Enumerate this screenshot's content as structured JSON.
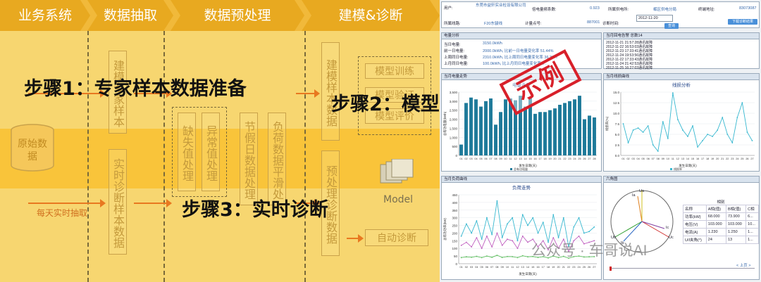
{
  "left": {
    "stages": [
      "业务系统",
      "数据抽取",
      "数据预处理",
      "建模&诊断"
    ],
    "source_db": "原始数据",
    "boxes": {
      "expert_sample": "建模专家样本",
      "realtime_sample": "实时诊断样本数据",
      "missing": "缺失值处理",
      "abnormal": "异常值处理",
      "holiday": "节假日数据处理",
      "load_smooth": "负荷数据平滑处",
      "model_data": "建模样本数据",
      "preprocess_data": "预处理诊断数据",
      "model_train": "模型训练",
      "model_verify": "模型验证",
      "model_eval": "模型评价",
      "model_label": "Model",
      "auto_diag": "自动诊断"
    },
    "daily_extract": "每天实时抽取",
    "step1": "步骤1：专家样本数据准备",
    "step2": "步骤2：模型",
    "step3": "步骤3：实时诊断"
  },
  "right": {
    "top": {
      "user_label": "用户:",
      "user_value": "东莞市益轩实业检设有限公司",
      "ratio_label": "倍电量频系数:",
      "ratio_value": "0.923",
      "station_label": "所属供电所:",
      "station_value": "岷区供电分局",
      "terminal_label": "终端地址:",
      "terminal_value": "83073087",
      "line_label": "所属线路:",
      "line_value": "F20东骏线",
      "meter_label": "计量点号:",
      "meter_value": "887001",
      "diag_label": "诊断时间:",
      "diag_value": "2012-11-20",
      "query_btn": "查询",
      "export_btn": "下载诊断结果"
    },
    "energy": {
      "title": "电量分析",
      "rows": [
        {
          "label": "当日电量:",
          "value": "3150.0kWh"
        },
        {
          "label": "前一日电量:",
          "value": "2000.0kWh, 比前一日电量变化率 51.44%"
        },
        {
          "label": "上周同日电量:",
          "value": "2310.0kWh, 比上周同日电量变化率 36.36%"
        },
        {
          "label": "上月同日电量:",
          "value": "100.0kWh, 比上月同日电量变化率 3..."
        }
      ]
    },
    "events": {
      "title": "当月回电告警 总数14",
      "items": [
        "2012-11-21 21:57:28通讯故障",
        "2012-11-22 16:53:03通讯故障",
        "2012-11-23 17:33:41通讯故障",
        "2012-11-24 19:53:56通讯故障",
        "2012-11-22 17:33:43通讯故障",
        "2012-11-24 21:42:53通讯故障",
        "2012-11-25 16:27:03通讯故障"
      ]
    },
    "stamp": "示例",
    "watermark": "公众号 · 车哥说AI",
    "charts": [
      {
        "panel_title": "当月电量走势",
        "chart_data": {
          "type": "bar",
          "title": "电量走势",
          "xlabel": "发生日期(天)",
          "ylabel": "总有功电量(kWh)",
          "ylim": [
            0,
            3500
          ],
          "yticks": [
            "0",
            "500",
            "1,000",
            "1,500",
            "2,000",
            "2,500",
            "3,000",
            "3,500"
          ],
          "categories": [
            "01",
            "02",
            "03",
            "04",
            "05",
            "06",
            "07",
            "08",
            "09",
            "10",
            "11",
            "12",
            "13",
            "14",
            "15",
            "16",
            "17",
            "18",
            "19",
            "20",
            "21",
            "22",
            "23",
            "24",
            "25",
            "26",
            "27",
            "28"
          ],
          "values": [
            600,
            2900,
            3200,
            3100,
            2700,
            3000,
            3150,
            1700,
            2400,
            3100,
            3150,
            3050,
            3300,
            2700,
            3200,
            2300,
            2400,
            2400,
            2500,
            2600,
            2800,
            2900,
            3000,
            3100,
            3300,
            2000,
            2200,
            2100
          ],
          "legend": [
            "总有功电量"
          ]
        }
      },
      {
        "panel_title": "当月线损曲线",
        "chart_data": {
          "type": "line",
          "title": "线损分析",
          "xlabel": "发生日期(天)",
          "ylabel": "线损率(%)",
          "ylim": [
            0,
            15.0
          ],
          "yticks": [
            "0.0",
            "2.5",
            "5.0",
            "7.5",
            "10.0",
            "12.5",
            "15.0"
          ],
          "categories": [
            "01",
            "02",
            "03",
            "04",
            "05",
            "06",
            "07",
            "08",
            "09",
            "10",
            "11",
            "12",
            "13",
            "14",
            "15",
            "16",
            "17",
            "18",
            "19",
            "20",
            "21",
            "22",
            "23",
            "24",
            "25",
            "26",
            "27"
          ],
          "values": [
            7.5,
            3.0,
            6.0,
            6.5,
            5.5,
            7.0,
            2.5,
            1.0,
            8.0,
            4.0,
            14.8,
            8.5,
            6.0,
            4.5,
            7.0,
            2.0,
            3.5,
            5.0,
            4.5,
            6.0,
            9.0,
            5.0,
            3.0,
            9.0,
            12.5,
            5.5,
            3.5
          ],
          "legend": [
            "线损率"
          ]
        }
      },
      {
        "panel_title": "当月负荷曲线",
        "chart_data": {
          "type": "line",
          "title": "负荷走势",
          "xlabel": "发生日期(天)",
          "ylabel": "总有功功率(kW)",
          "ylim": [
            0,
            450
          ],
          "yticks": [
            "0",
            "50",
            "100",
            "150",
            "200",
            "250",
            "300",
            "350",
            "400",
            "450"
          ],
          "categories": [
            "01",
            "02",
            "03",
            "04",
            "05",
            "06",
            "07",
            "08",
            "09",
            "10",
            "11",
            "12",
            "13",
            "14",
            "15",
            "16",
            "17",
            "18",
            "19",
            "20",
            "21",
            "22",
            "23",
            "24",
            "25",
            "26",
            "27"
          ],
          "series": [
            {
              "values": [
                180,
                260,
                200,
                280,
                160,
                300,
                190,
                410,
                170,
                260,
                300,
                150,
                320,
                250,
                300,
                200,
                270,
                140,
                320,
                170,
                300,
                110,
                240,
                300,
                200,
                210,
                240
              ]
            },
            {
              "values": [
                120,
                140,
                110,
                170,
                100,
                180,
                110,
                200,
                120,
                160,
                150,
                100,
                180,
                140,
                160,
                110,
                150,
                90,
                170,
                100,
                160,
                80,
                150,
                180,
                130,
                140,
                150
              ]
            },
            {
              "values": [
                40,
                45,
                42,
                48,
                40,
                50,
                42,
                55,
                41,
                47,
                46,
                40,
                52,
                45,
                47,
                41,
                46,
                38,
                50,
                40,
                48,
                36,
                46,
                50,
                44,
                45,
                46
              ]
            }
          ]
        }
      }
    ],
    "phasor": {
      "title": "六角图",
      "labels": [
        "Ua",
        "Ub",
        "Uc",
        "Ia",
        "Ib",
        "Ic"
      ],
      "table_header": [
        "名称",
        "A相(值)",
        "B相(值)",
        "C相"
      ],
      "table_group": "相别",
      "rows": [
        [
          "功率(kW)",
          "68.000",
          "73.900",
          "6..."
        ],
        [
          "电压(V)",
          "103.000",
          "103.000",
          "10..."
        ],
        [
          "电流(A)",
          "1.230",
          "1.250",
          "1..."
        ],
        [
          "U/I夹角(°)",
          "24",
          "13",
          "1..."
        ]
      ],
      "next_link": "< 上页 >"
    }
  }
}
